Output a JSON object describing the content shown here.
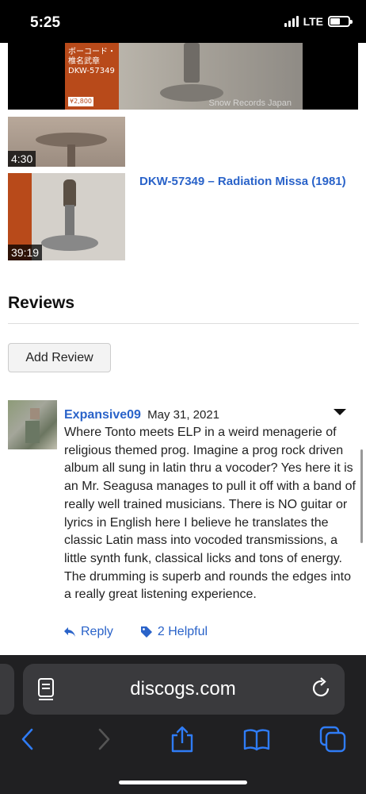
{
  "status_bar": {
    "time": "5:25",
    "network": "LTE",
    "battery_level": 0.55
  },
  "videos": {
    "player_watermark": "Snow Records Japan",
    "obi_text": "ボーコード・ 椎名武章 DKW-57349",
    "obi_price": "¥2,800",
    "items": [
      {
        "duration": "4:30",
        "title": ""
      },
      {
        "duration": "39:19",
        "title": "DKW-57349 – Radiation Missa (1981)"
      }
    ]
  },
  "reviews": {
    "heading": "Reviews",
    "add_button": "Add Review",
    "list": [
      {
        "author": "Expansive09",
        "date": "May 31, 2021",
        "text": "Where Tonto meets ELP in a weird menagerie of religious themed prog. Imagine a prog rock driven album all sung in latin thru a vocoder? Yes here it is an Mr. Seagusa manages to pull it off with a band of really well trained musicians. There is NO guitar or lyrics in English here I believe he translates the classic Latin mass into vocoded transmissions, a little synth funk, classical licks and tons of energy. The drumming is superb and rounds the edges into a really great listening experience.",
        "reply_label": "Reply",
        "helpful_label": "2 Helpful"
      }
    ]
  },
  "browser": {
    "url": "discogs.com",
    "icons": [
      "reader-icon",
      "reload-icon",
      "back-icon",
      "forward-icon",
      "share-icon",
      "bookmarks-icon",
      "tabs-icon"
    ],
    "colors": {
      "accent": "#2f7cf6",
      "chrome_bg": "#202022",
      "field_bg": "#3a3a3d"
    }
  }
}
